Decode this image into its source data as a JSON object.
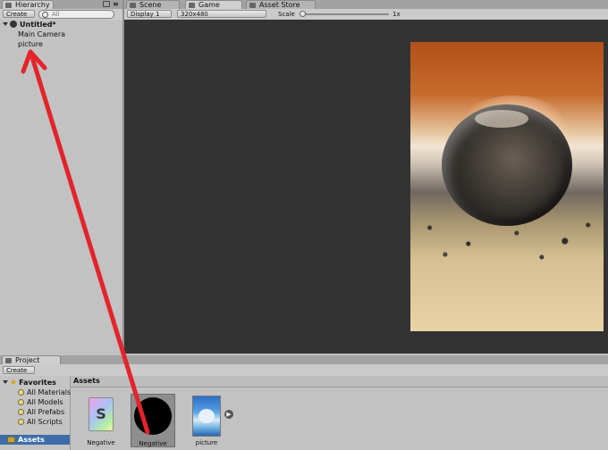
{
  "hierarchy": {
    "tab_label": "Hierarchy",
    "create_label": "Create",
    "search_placeholder": "All",
    "scene_name": "Untitled*",
    "items": [
      "Main Camera",
      "picture"
    ]
  },
  "tabs": [
    {
      "label": "Scene",
      "icon": "scene-icon"
    },
    {
      "label": "Game",
      "icon": "game-icon"
    },
    {
      "label": "Asset Store",
      "icon": "asset-store-icon"
    }
  ],
  "game_toolbar": {
    "display": "Display 1",
    "resolution": "320x480",
    "scale_label": "Scale",
    "scale_value": "1x",
    "scale_fraction": 0
  },
  "project": {
    "tab_label": "Project",
    "create_label": "Create",
    "favorites_label": "Favorites",
    "favorites": [
      "All Materials",
      "All Models",
      "All Prefabs",
      "All Scripts"
    ],
    "assets_root": "Assets",
    "breadcrumb": "Assets",
    "assets": [
      {
        "name": "Negative",
        "icon": "shader-icon"
      },
      {
        "name": "Negative",
        "icon": "material-icon"
      },
      {
        "name": "picture",
        "icon": "texture-icon"
      }
    ]
  },
  "colors": {
    "annotation_arrow": "#e3242b",
    "game_background": "#333333",
    "selection": "#3d6da8"
  }
}
